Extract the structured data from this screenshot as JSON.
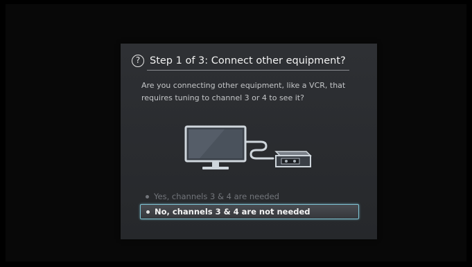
{
  "dialog": {
    "help_icon_glyph": "?",
    "title": "Step 1 of 3: Connect other equipment?",
    "question": "Are you connecting other equipment, like a VCR, that requires tuning to channel 3 or 4 to see it?",
    "illustration": {
      "icons": [
        "tv-icon",
        "cable-icon",
        "vcr-icon"
      ]
    },
    "options": [
      {
        "label": "Yes, channels 3 & 4 are needed",
        "selected": false
      },
      {
        "label": "No, channels 3 & 4 are not needed",
        "selected": true
      }
    ]
  },
  "colors": {
    "highlight_border": "#7fc4d4",
    "dialog_background": "#2e3034",
    "illustration_stroke": "#cfd6dc"
  }
}
